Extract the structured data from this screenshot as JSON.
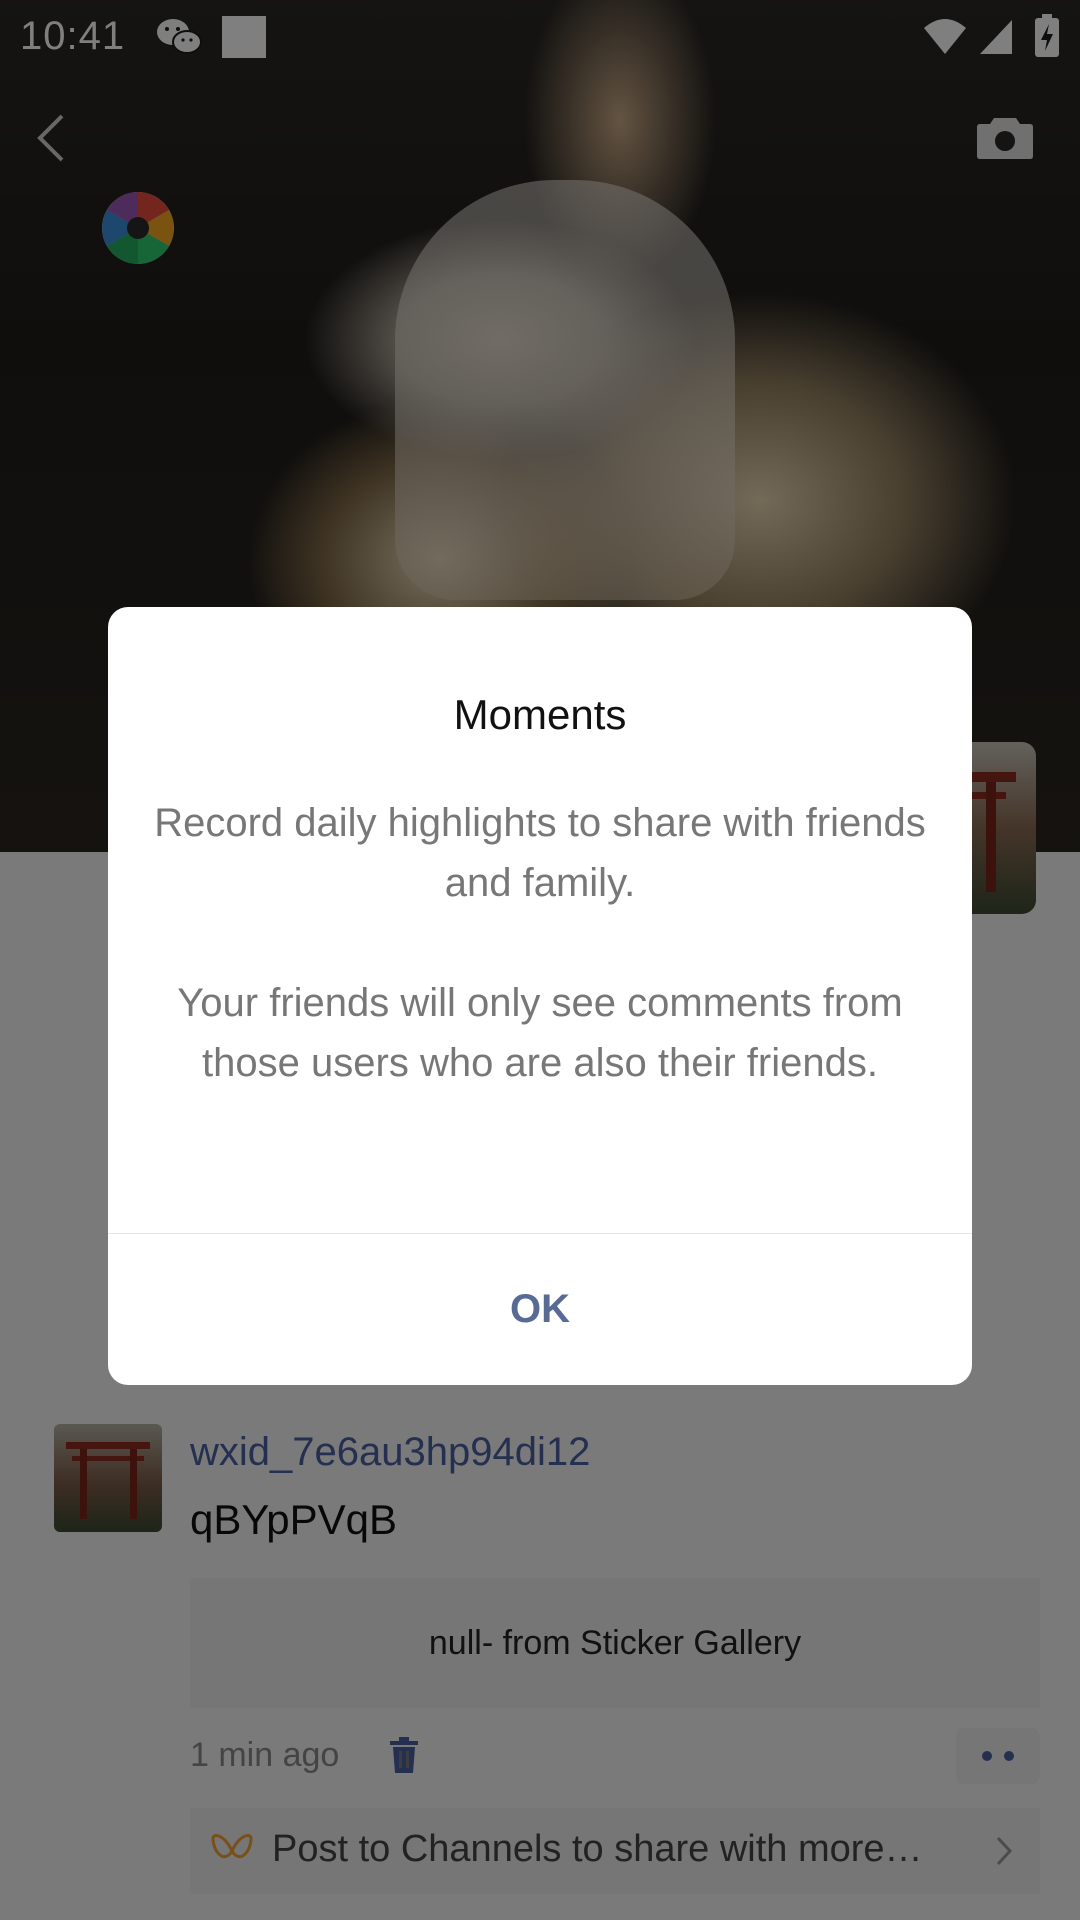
{
  "status_bar": {
    "time": "10:41",
    "icons": [
      "wechat-icon",
      "notification-square-icon",
      "wifi-icon",
      "signal-icon",
      "battery-charging-icon"
    ]
  },
  "header": {
    "back_icon": "back-icon",
    "camera_icon": "camera-icon",
    "app_icon": "aperture-icon"
  },
  "dialog": {
    "title": "Moments",
    "paragraph1": "Record daily highlights to share with friends and family.",
    "paragraph2": "Your friends will only see comments from those users who are also their friends.",
    "ok_label": "OK"
  },
  "post": {
    "username": "wxid_7e6au3hp94di12",
    "text": "qBYpPVqB",
    "sticker_text": "null- from Sticker Gallery",
    "time_ago": "1 min ago",
    "channels_text": "Post to Channels to share with more…"
  },
  "colors": {
    "link_blue": "#576b95",
    "scrim": "rgba(0,0,0,0.5)",
    "dialog_bg": "#ffffff"
  }
}
